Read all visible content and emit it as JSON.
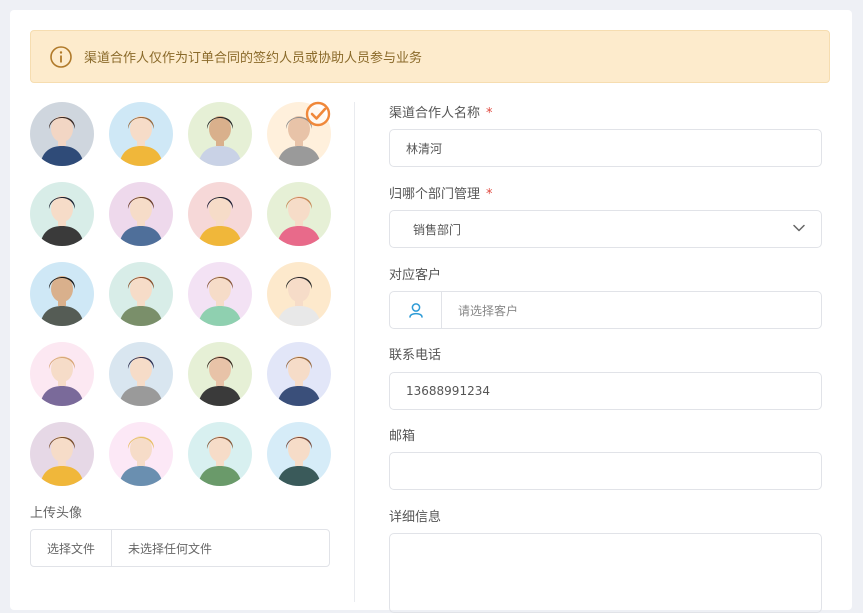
{
  "alert": {
    "text": "渠道合作人仅作为订单合同的签约人员或协助人员参与业务",
    "icon": "info-icon"
  },
  "avatars": {
    "selected_index": 3,
    "items": [
      {
        "bg": "#cfd6de",
        "hair": "#3b2a24",
        "shirt": "#2f4b78",
        "skin": "#f2d6c4"
      },
      {
        "bg": "#cfe8f6",
        "hair": "#9a6a3e",
        "shirt": "#f0b73a",
        "skin": "#f6dcc8"
      },
      {
        "bg": "#e6f0d6",
        "hair": "#2a2a2a",
        "shirt": "#c9d2e6",
        "skin": "#d9b08c"
      },
      {
        "bg": "#fff0dc",
        "hair": "#8d8d8d",
        "shirt": "#9a9a9a",
        "skin": "#e8c3a8"
      },
      {
        "bg": "#d8ede8",
        "hair": "#1f2433",
        "shirt": "#3a3a3a",
        "skin": "#f6dcc8"
      },
      {
        "bg": "#eed9ec",
        "hair": "#6b3f2a",
        "shirt": "#4f6f9a",
        "skin": "#f6dcc8"
      },
      {
        "bg": "#f6d8d8",
        "hair": "#1d1f33",
        "shirt": "#f0b73a",
        "skin": "#f6dcc8"
      },
      {
        "bg": "#e6f0d6",
        "hair": "#c98a5a",
        "shirt": "#e86a8a",
        "skin": "#f6dcc8"
      },
      {
        "bg": "#cfe8f6",
        "hair": "#1a1a1a",
        "shirt": "#555c55",
        "skin": "#d9b08c"
      },
      {
        "bg": "#d8ede8",
        "hair": "#8a4f2c",
        "shirt": "#7a8f6a",
        "skin": "#f6dcc8"
      },
      {
        "bg": "#f3e2f4",
        "hair": "#8a5a3a",
        "shirt": "#8fd0b0",
        "skin": "#f6dcc8"
      },
      {
        "bg": "#fde9cc",
        "hair": "#2a2a2a",
        "shirt": "#e8e8e8",
        "skin": "#f6dcc8"
      },
      {
        "bg": "#fce8f2",
        "hair": "#d8a878",
        "shirt": "#7a6a9a",
        "skin": "#f6dcc8"
      },
      {
        "bg": "#d9e6f0",
        "hair": "#2f3050",
        "shirt": "#9a9a9a",
        "skin": "#f6dcc8"
      },
      {
        "bg": "#e6f0d6",
        "hair": "#3a2a20",
        "shirt": "#3a3a3a",
        "skin": "#e8c3a8"
      },
      {
        "bg": "#e2e6f8",
        "hair": "#9a6a3e",
        "shirt": "#3a4f7a",
        "skin": "#f6dcc8"
      },
      {
        "bg": "#e6d8e6",
        "hair": "#7a4f2c",
        "shirt": "#f0b73a",
        "skin": "#f6dcc8"
      },
      {
        "bg": "#fce8f6",
        "hair": "#e8c068",
        "shirt": "#6a8fb0",
        "skin": "#f6dcc8"
      },
      {
        "bg": "#d8f0f0",
        "hair": "#8a5a3a",
        "shirt": "#6a9a6a",
        "skin": "#f6dcc8"
      },
      {
        "bg": "#d6ecf8",
        "hair": "#7a4a3a",
        "shirt": "#3a5a5a",
        "skin": "#f6dcc8"
      }
    ]
  },
  "upload": {
    "label": "上传头像",
    "button": "选择文件",
    "status": "未选择任何文件"
  },
  "form": {
    "partner_name": {
      "label": "渠道合作人名称",
      "required": "*",
      "value": "林清河"
    },
    "department": {
      "label": "归哪个部门管理",
      "required": "*",
      "value": "销售部门",
      "icon": "chevron-down-icon"
    },
    "customer": {
      "label": "对应客户",
      "placeholder": "请选择客户",
      "icon": "user-icon"
    },
    "phone": {
      "label": "联系电话",
      "value": "13688991234"
    },
    "email": {
      "label": "邮箱",
      "value": ""
    },
    "details": {
      "label": "详细信息",
      "value": ""
    }
  },
  "colors": {
    "accent": "#2e9bd6",
    "required": "#e0473d",
    "alert_bg": "#fdebcc",
    "check": "#f0883a"
  }
}
